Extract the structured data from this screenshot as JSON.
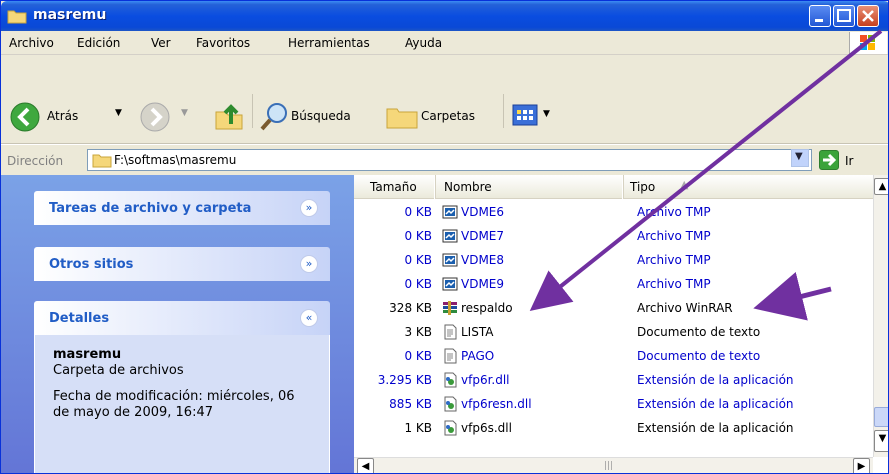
{
  "window": {
    "title": "masremu"
  },
  "menu": [
    "Archivo",
    "Edición",
    "Ver",
    "Favoritos",
    "Herramientas",
    "Ayuda"
  ],
  "toolbar": {
    "back_label": "Atrás",
    "search_label": "Búsqueda",
    "folders_label": "Carpetas"
  },
  "address": {
    "label": "Dirección",
    "value": "F:\\softmas\\masremu",
    "go_label": "Ir"
  },
  "taskpane": {
    "file_tasks": "Tareas de archivo y carpeta",
    "other_places": "Otros sitios",
    "details": "Detalles",
    "details_name": "masremu",
    "details_type": "Carpeta de archivos",
    "details_date": "Fecha de modificación: miércoles, 06 de mayo de 2009, 16:47"
  },
  "columns": {
    "size": "Tamaño",
    "name": "Nombre",
    "type": "Tipo"
  },
  "files": [
    {
      "size": "0 KB",
      "name": "VDME6",
      "type": "Archivo TMP",
      "color": "blue",
      "icon": "tmp-file-icon"
    },
    {
      "size": "0 KB",
      "name": "VDME7",
      "type": "Archivo TMP",
      "color": "blue",
      "icon": "tmp-file-icon"
    },
    {
      "size": "0 KB",
      "name": "VDME8",
      "type": "Archivo TMP",
      "color": "blue",
      "icon": "tmp-file-icon"
    },
    {
      "size": "0 KB",
      "name": "VDME9",
      "type": "Archivo TMP",
      "color": "blue",
      "icon": "tmp-file-icon"
    },
    {
      "size": "328 KB",
      "name": "respaldo",
      "type": "Archivo WinRAR",
      "color": "black",
      "icon": "winrar-icon"
    },
    {
      "size": "3 KB",
      "name": "LISTA",
      "type": "Documento de texto",
      "color": "black",
      "icon": "text-file-icon"
    },
    {
      "size": "0 KB",
      "name": "PAGO",
      "type": "Documento de texto",
      "color": "blue",
      "icon": "text-file-icon"
    },
    {
      "size": "3.295 KB",
      "name": "vfp6r.dll",
      "type": "Extensión de la aplicación",
      "color": "blue",
      "icon": "dll-icon"
    },
    {
      "size": "885 KB",
      "name": "vfp6resn.dll",
      "type": "Extensión de la aplicación",
      "color": "blue",
      "icon": "dll-icon"
    },
    {
      "size": "1 KB",
      "name": "vfp6s.dll",
      "type": "Extensión de la aplicación",
      "color": "black",
      "icon": "dll-icon"
    }
  ],
  "colors": {
    "annotation_arrow": "#7030A0",
    "link_blue": "#0000CC",
    "titlebar": "#0A4DE0"
  }
}
